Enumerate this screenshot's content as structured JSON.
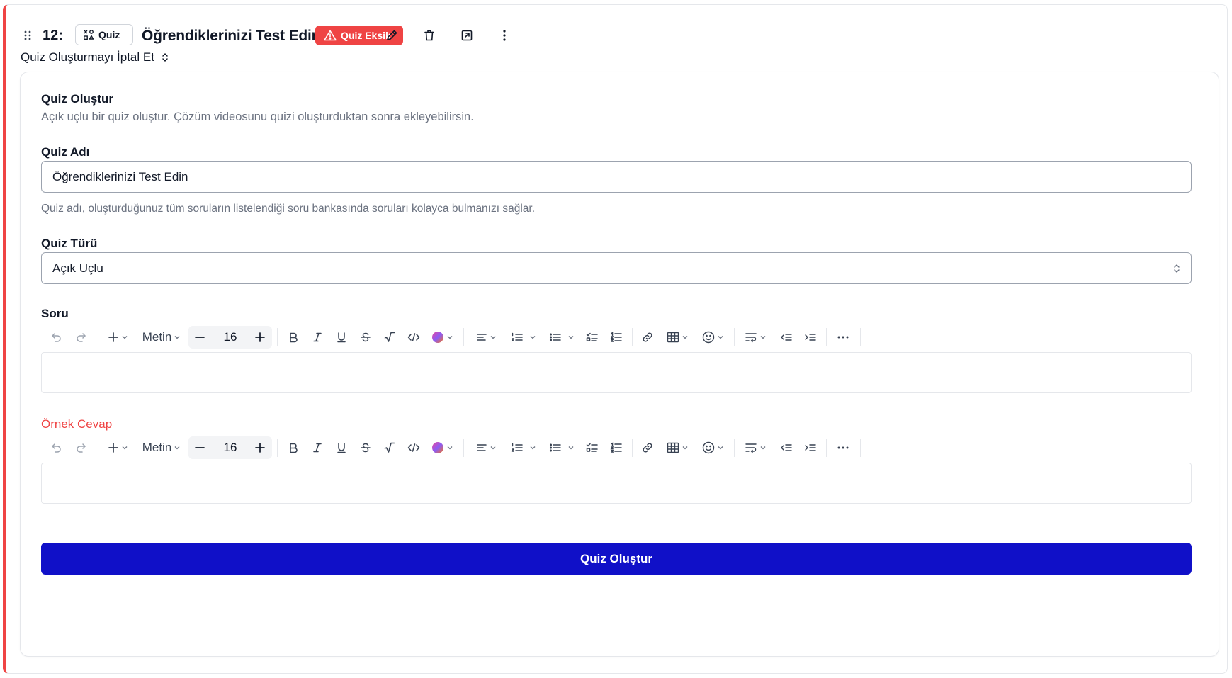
{
  "header": {
    "lesson_number": "12:",
    "chip_label": "Quiz",
    "title": "Öğrendiklerinizi Test Edin",
    "badge_label": "Quiz Eksik"
  },
  "cancel": {
    "label": "Quiz Oluşturmayı İptal Et"
  },
  "form": {
    "title": "Quiz Oluştur",
    "description": "Açık uçlu bir quiz oluştur. Çözüm videosunu quizi oluşturduktan sonra ekleyebilirsin.",
    "name_label": "Quiz Adı",
    "name_value": "Öğrendiklerinizi Test Edin",
    "name_hint": "Quiz adı, oluşturduğunuz tüm soruların listelendiği soru bankasında soruları kolayca bulmanızı sağlar.",
    "type_label": "Quiz Türü",
    "type_value": "Açık Uçlu",
    "question_label": "Soru",
    "answer_label": "Örnek Cevap",
    "submit_label": "Quiz Oluştur"
  },
  "toolbar": {
    "text_style": "Metin",
    "font_size": "16"
  },
  "colors": {
    "accent_red": "#ef4444",
    "primary_blue": "#1010c8"
  }
}
